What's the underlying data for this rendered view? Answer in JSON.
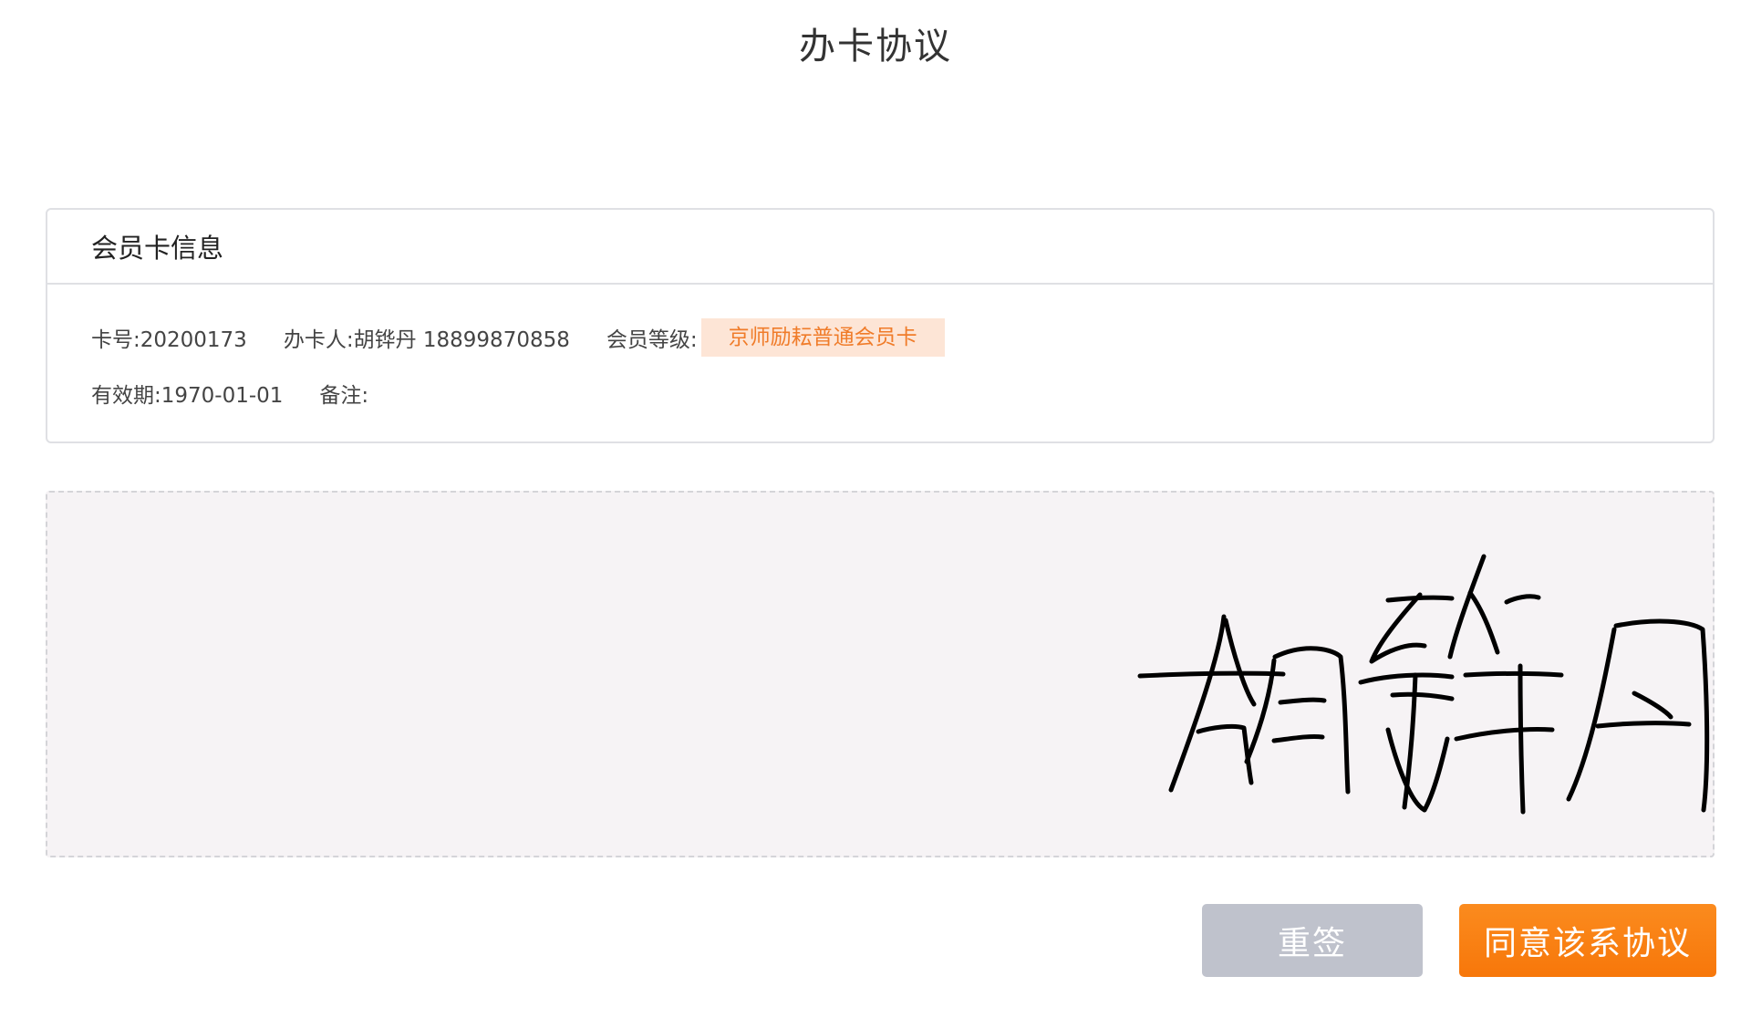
{
  "header": {
    "title": "办卡协议"
  },
  "card": {
    "title": "会员卡信息",
    "card_no": "卡号:20200173",
    "holder": "办卡人:胡铧丹 18899870858",
    "level_label": "会员等级:",
    "level_value": "京师励耘普通会员卡",
    "validity": "有效期:1970-01-01",
    "remark": "备注:"
  },
  "signature": {
    "text": "胡铧丹",
    "stroke_color": "#000000",
    "background": "#f6f3f5"
  },
  "actions": {
    "resign_label": "重签",
    "agree_label": "同意该系协议"
  },
  "colors": {
    "accent": "#f7770a",
    "badge_bg": "#fde5d6",
    "badge_text": "#f07c2a",
    "disabled_button": "#bfc2cc"
  }
}
